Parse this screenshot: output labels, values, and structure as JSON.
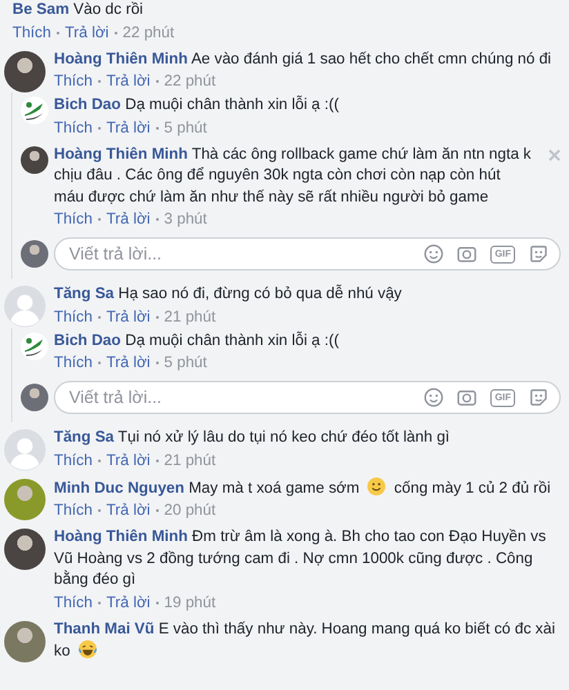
{
  "comments": [
    {
      "author": "Be Sam",
      "parts": [
        {
          "kind": "text",
          "text": "Vào dc rồi"
        }
      ],
      "like": "Thích",
      "reply": "Trả lời",
      "time": "22 phút",
      "avatar": {
        "kind": "none"
      }
    },
    {
      "author": "Hoàng Thiên Minh",
      "parts": [
        {
          "kind": "text",
          "text": "Ae vào đánh giá 1 sao hết cho chết cmn chúng nó đi"
        }
      ],
      "like": "Thích",
      "reply": "Trả lời",
      "time": "22 phút",
      "avatar": {
        "kind": "photo",
        "color": "#4a4442"
      },
      "replies": [
        {
          "author": "Bich Dao",
          "parts": [
            {
              "kind": "text",
              "text": "Dạ muội chân thành xin lỗi ạ :(("
            }
          ],
          "like": "Thích",
          "reply": "Trả lời",
          "time": "5 phút",
          "avatar": {
            "kind": "logo"
          },
          "show_remove": false
        },
        {
          "author": "Hoàng Thiên Minh",
          "parts": [
            {
              "kind": "text",
              "text": "Thà các ông rollback game chứ làm ăn ntn ngta k chịu đâu . Các ông để nguyên 30k ngta còn chơi còn nạp còn hút máu được chứ làm ăn như thế này sẽ rất nhiều người bỏ game"
            }
          ],
          "like": "Thích",
          "reply": "Trả lời",
          "time": "3 phút",
          "avatar": {
            "kind": "photo",
            "color": "#4a4442"
          },
          "show_remove": true
        }
      ],
      "reply_box": {
        "placeholder": "Viết trả lời...",
        "gif": "GIF",
        "avatar": {
          "kind": "photo",
          "color": "#6d6f78"
        }
      }
    },
    {
      "author": "Tăng Sa",
      "parts": [
        {
          "kind": "text",
          "text": "Hạ sao nó đi, đừng có bỏ qua dễ nhú vậy"
        }
      ],
      "like": "Thích",
      "reply": "Trả lời",
      "time": "21 phút",
      "avatar": {
        "kind": "default"
      },
      "replies": [
        {
          "author": "Bich Dao",
          "parts": [
            {
              "kind": "text",
              "text": "Dạ muội chân thành xin lỗi ạ :(("
            }
          ],
          "like": "Thích",
          "reply": "Trả lời",
          "time": "5 phút",
          "avatar": {
            "kind": "logo"
          },
          "show_remove": false
        }
      ],
      "reply_box": {
        "placeholder": "Viết trả lời...",
        "gif": "GIF",
        "avatar": {
          "kind": "photo",
          "color": "#6d6f78"
        }
      }
    },
    {
      "author": "Tăng Sa",
      "parts": [
        {
          "kind": "text",
          "text": "Tụi nó xử lý lâu do tụi nó keo chứ đéo tốt lành gì"
        }
      ],
      "like": "Thích",
      "reply": "Trả lời",
      "time": "21 phút",
      "avatar": {
        "kind": "default"
      }
    },
    {
      "author": "Minh Duc Nguyen",
      "parts": [
        {
          "kind": "text",
          "text": "May mà t xoá game sớm"
        },
        {
          "kind": "smile"
        },
        {
          "kind": "text",
          "text": "cống mày 1 củ 2 đủ rồi"
        }
      ],
      "like": "Thích",
      "reply": "Trả lời",
      "time": "20 phút",
      "avatar": {
        "kind": "photo",
        "color": "#8a9a2a"
      }
    },
    {
      "author": "Hoàng Thiên Minh",
      "parts": [
        {
          "kind": "text",
          "text": "Đm trừ âm là xong à. Bh cho tao con Đạo Huyền vs Vũ Hoàng vs 2 đồng tướng cam đi . Nợ cmn 1000k cũng được . Công bằng đéo gì"
        }
      ],
      "like": "Thích",
      "reply": "Trả lời",
      "time": "19 phút",
      "avatar": {
        "kind": "photo",
        "color": "#4a4442"
      }
    },
    {
      "author": "Thanh Mai Vũ",
      "parts": [
        {
          "kind": "text",
          "text": "E vào thì thấy như này. Hoang mang quá ko biết có đc xài ko"
        },
        {
          "kind": "laugh"
        }
      ],
      "avatar": {
        "kind": "photo",
        "color": "#7a7860"
      }
    }
  ]
}
